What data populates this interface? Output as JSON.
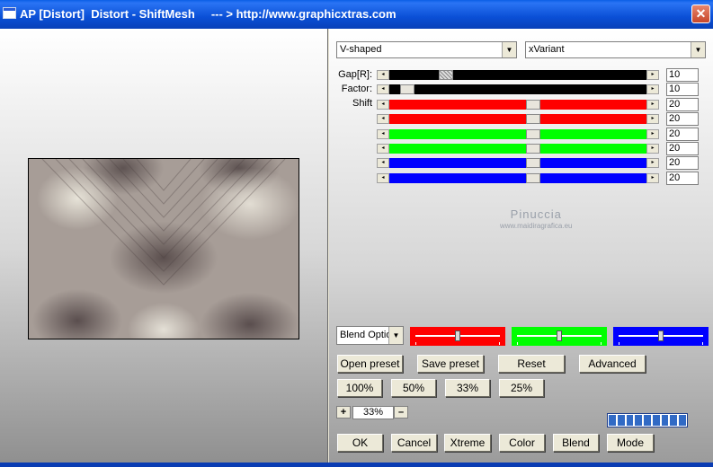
{
  "window": {
    "title": "AP [Distort]  Distort - ShiftMesh     --- > http://www.graphicxtras.com",
    "close_glyph": "✕"
  },
  "dropdowns": {
    "mode": "V-shaped",
    "variant": "xVariant",
    "arrow": "▼"
  },
  "labels": {
    "gap": "Gap[R]:",
    "factor": "Factor:",
    "shift": "Shift"
  },
  "sliders": [
    {
      "name": "gap",
      "value": "10",
      "fill_color": "#000000",
      "thumb_fraction": 0.22,
      "hatched": true
    },
    {
      "name": "factor",
      "value": "10",
      "fill_color": "#000000",
      "thumb_fraction": 0.07,
      "hatched": false
    },
    {
      "name": "shift-red-1",
      "value": "20",
      "fill_color": "#ff0000",
      "thumb_fraction": 0.56,
      "hatched": false
    },
    {
      "name": "shift-red-2",
      "value": "20",
      "fill_color": "#ff0000",
      "thumb_fraction": 0.56,
      "hatched": false
    },
    {
      "name": "shift-green-1",
      "value": "20",
      "fill_color": "#00ff00",
      "thumb_fraction": 0.56,
      "hatched": false
    },
    {
      "name": "shift-green-2",
      "value": "20",
      "fill_color": "#00ff00",
      "thumb_fraction": 0.56,
      "hatched": false
    },
    {
      "name": "shift-blue-1",
      "value": "20",
      "fill_color": "#0000ff",
      "thumb_fraction": 0.56,
      "hatched": false
    },
    {
      "name": "shift-blue-2",
      "value": "20",
      "fill_color": "#0000ff",
      "thumb_fraction": 0.56,
      "hatched": false
    }
  ],
  "watermark": {
    "line1": "Pinuccia",
    "line2": "www.maidiragrafica.eu"
  },
  "blend": {
    "select_label": "Blend Optio",
    "color_sliders": [
      {
        "color": "#ff0000",
        "fraction": 0.5
      },
      {
        "color": "#00ff00",
        "fraction": 0.5
      },
      {
        "color": "#0000ff",
        "fraction": 0.5
      }
    ]
  },
  "buttons": {
    "open_preset": "Open preset",
    "save_preset": "Save preset",
    "reset": "Reset",
    "advanced": "Advanced",
    "zoom_100": "100%",
    "zoom_50": "50%",
    "zoom_33": "33%",
    "zoom_25": "25%",
    "ok": "OK",
    "cancel": "Cancel",
    "xtreme": "Xtreme",
    "color": "Color",
    "blend": "Blend",
    "mode": "Mode"
  },
  "zoom": {
    "plus": "+",
    "minus": "–",
    "value": "33%"
  },
  "progress": {
    "fraction": 1.0,
    "segments": 9
  }
}
